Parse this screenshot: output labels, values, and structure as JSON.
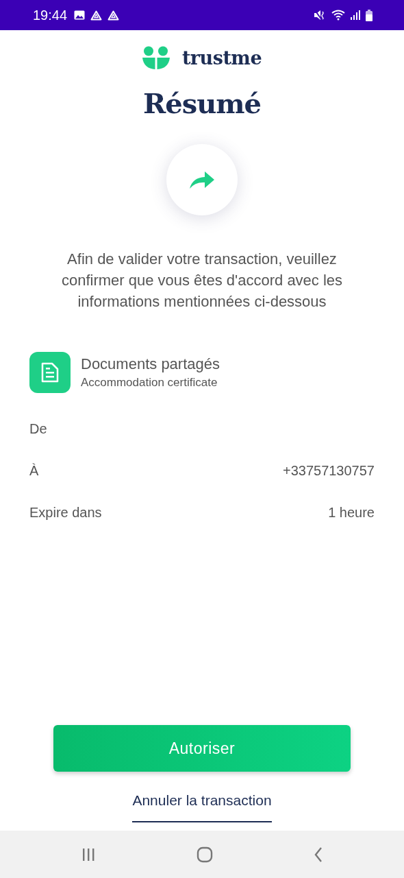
{
  "status_bar": {
    "time": "19:44"
  },
  "brand": {
    "name": "trustme"
  },
  "title": "Résumé",
  "message": "Afin de valider votre transaction, veuillez confirmer que vous êtes d'accord avec les informations mentionnées ci-dessous",
  "documents": {
    "title": "Documents partagés",
    "subtitle": "Accommodation certificate"
  },
  "details": [
    {
      "label": "De"
    },
    {
      "label": "À",
      "value": "+33757130757"
    },
    {
      "label": "Expire dans",
      "value": "1 heure"
    }
  ],
  "primary_button": "Autoriser",
  "cancel_link": "Annuler la transaction"
}
